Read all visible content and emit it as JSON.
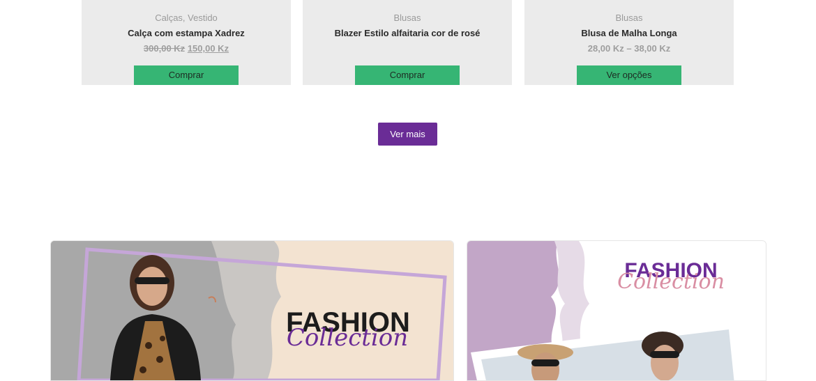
{
  "products": [
    {
      "category": "Calças, Vestido",
      "name": "Calça com estampa Xadrez",
      "old_price": "300,00 Kz",
      "price": "150,00 Kz",
      "button": "Comprar"
    },
    {
      "category": "Blusas",
      "name": "Blazer Estilo alfaitaria cor de rosé",
      "old_price": "",
      "price": "",
      "button": "Comprar"
    },
    {
      "category": "Blusas",
      "name": "Blusa de Malha Longa",
      "old_price": "",
      "price": "28,00 Kz – 38,00 Kz",
      "button": "Ver opções"
    }
  ],
  "load_more": {
    "label": "Ver mais"
  },
  "banners": [
    {
      "title": "FASHION",
      "script": "Collection"
    },
    {
      "title": "FASHION",
      "script": "Collection"
    }
  ],
  "colors": {
    "button_green": "#36b574",
    "brand_purple": "#6a2c96",
    "card_bg": "#ebebeb"
  }
}
